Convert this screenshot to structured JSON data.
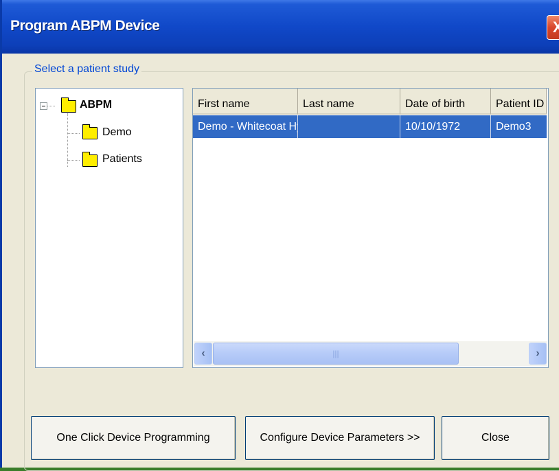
{
  "window": {
    "title": "Program ABPM Device",
    "close_glyph": "X"
  },
  "group": {
    "label": "Select a patient study"
  },
  "tree": {
    "root": {
      "label": "ABPM",
      "icon": "folder-icon",
      "expander": "minus"
    },
    "children": [
      {
        "label": "Demo",
        "icon": "folder-open-icon"
      },
      {
        "label": "Patients",
        "icon": "folder-icon"
      }
    ]
  },
  "table": {
    "columns": [
      "First name",
      "Last name",
      "Date of birth",
      "Patient ID"
    ],
    "rows": [
      {
        "first_name": "Demo - Whitecoat Hyp",
        "last_name": "",
        "dob": "10/10/1972",
        "patient_id": "Demo3",
        "selected": true
      }
    ]
  },
  "scrollbar": {
    "left_arrow": "‹",
    "right_arrow": "›",
    "grip": "|||"
  },
  "buttons": {
    "one_click": "One Click Device Programming",
    "configure": "Configure Device Parameters >>",
    "close": "Close"
  },
  "colors": {
    "titlebar": "#1048c8",
    "selection": "#316ac5",
    "group_label": "#0046d5",
    "window_bg": "#ece9d8"
  }
}
